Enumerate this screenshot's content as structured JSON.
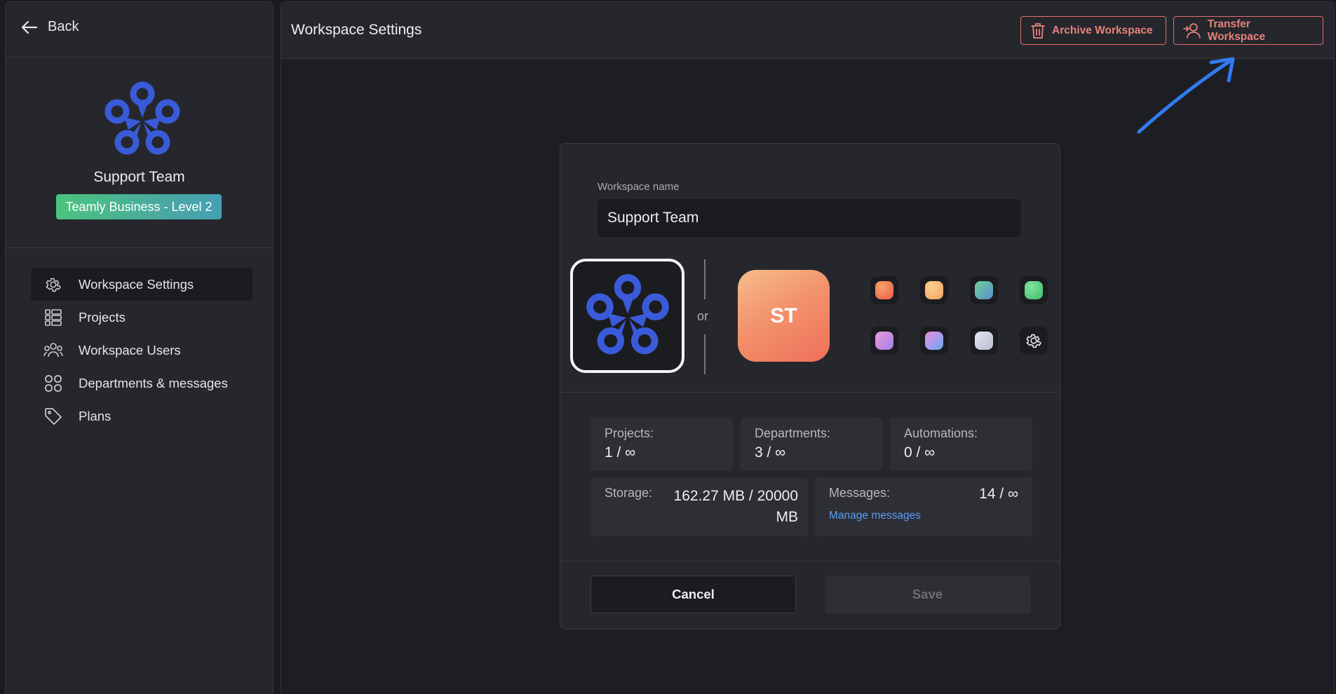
{
  "sidebar": {
    "back_label": "Back",
    "team_name": "Support Team",
    "plan_badge": "Teamly Business - Level 2",
    "nav": [
      {
        "label": "Workspace Settings",
        "icon": "gear-icon",
        "active": true
      },
      {
        "label": "Projects",
        "icon": "list-icon"
      },
      {
        "label": "Workspace Users",
        "icon": "users-icon"
      },
      {
        "label": "Departments & messages",
        "icon": "grid-icon"
      },
      {
        "label": "Plans",
        "icon": "tag-icon"
      }
    ]
  },
  "header": {
    "title": "Workspace Settings",
    "archive_label": "Archive Workspace",
    "transfer_label": "Transfer Workspace"
  },
  "form": {
    "name_label": "Workspace name",
    "name_value": "Support Team",
    "or_label": "or",
    "initials": "ST",
    "swatches": [
      "#f0703f",
      "#f6b16a",
      "#5fa88f",
      "#48c777",
      "#c48ae0",
      "#8a8df2",
      "#c9ccdc"
    ]
  },
  "stats": {
    "projects": {
      "label": "Projects:",
      "value": "1 / ∞"
    },
    "departments": {
      "label": "Departments:",
      "value": "3 / ∞"
    },
    "automations": {
      "label": "Automations:",
      "value": "0 / ∞"
    },
    "storage": {
      "label": "Storage:",
      "value_line1": "162.27 MB / 20000",
      "value_line2": "MB"
    },
    "messages": {
      "label": "Messages:",
      "value": "14 / ∞",
      "link": "Manage messages"
    }
  },
  "actions": {
    "cancel": "Cancel",
    "save": "Save"
  },
  "colors": {
    "accent_red": "#e8817b",
    "logo_blue": "#3a5bd9",
    "link_blue": "#5b9bf5",
    "annotation_arrow": "#2f7bef"
  }
}
